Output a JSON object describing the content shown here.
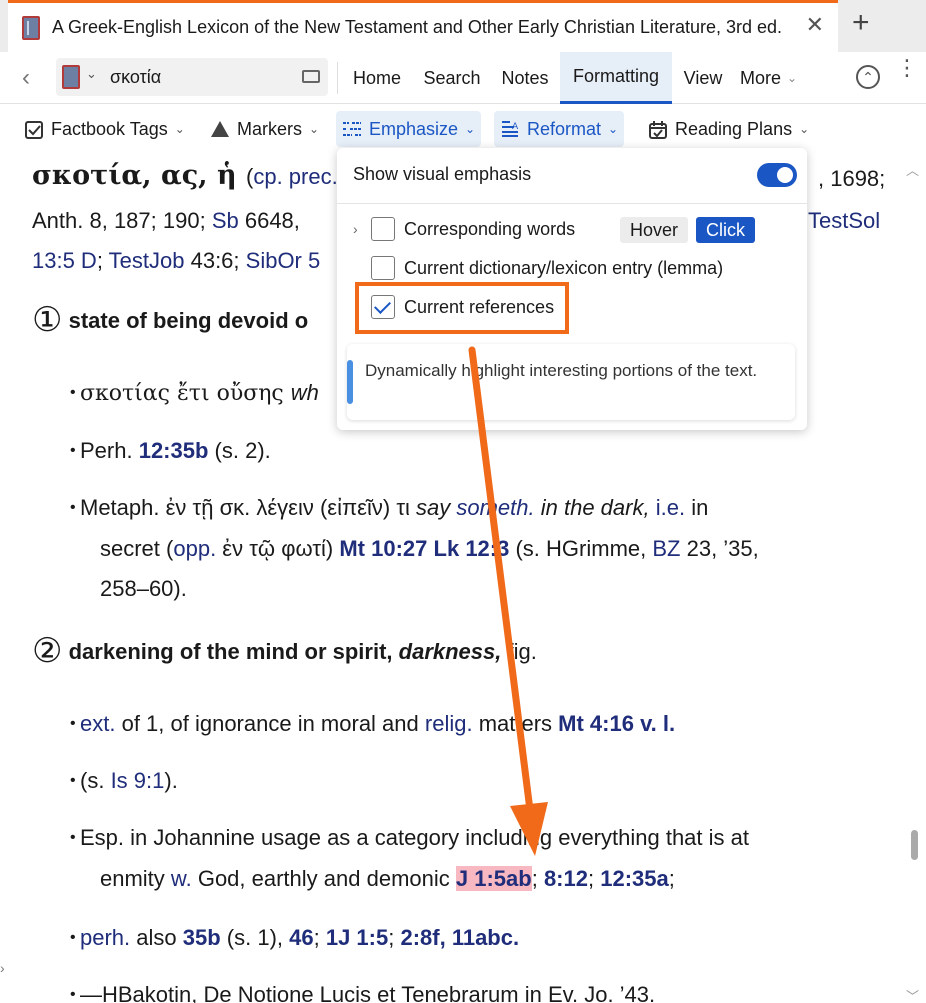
{
  "tab": {
    "title": "A Greek-English Lexicon of the New Testament and Other Early Christian Literature, 3rd ed.",
    "close": "✕",
    "add": "+"
  },
  "nav": {
    "reference": "σκοτία",
    "menus": [
      "Home",
      "Search",
      "Notes",
      "Formatting",
      "View",
      "More"
    ],
    "active_menu": "Formatting"
  },
  "toolbar": {
    "factbook": "Factbook Tags",
    "markers": "Markers",
    "emphasize": "Emphasize",
    "reformat": "Reformat",
    "reading_plans": "Reading Plans"
  },
  "panel": {
    "show_visual_emphasis": "Show visual emphasis",
    "corresponding_words": "Corresponding words",
    "hover": "Hover",
    "click": "Click",
    "current_lemma": "Current dictionary/lexicon entry (lemma)",
    "current_references": "Current references",
    "info": "Dynamically highlight interesting portions of the text.",
    "toggle_on": true
  },
  "entry": {
    "headword": "σκοτία, ας, ἡ",
    "l1_paren": "(",
    "l1_cp": "cp. prec.",
    "l1_end": ", 1698;",
    "l2a": "Anth. 8, 187; 190; ",
    "l2_sb": "Sb",
    "l2b": " 6648,",
    "l2_testsol": "TestSol",
    "l3_ref": "13:5 D",
    "l3_sep1": "; ",
    "l3_testjob": "TestJob",
    "l3_mid": " 43:6; ",
    "l3_sibor": "SibOr 5",
    "sense1_num": "①",
    "sense1": "state of being devoid o",
    "b1_greek": "σκοτίας ἔτι οὔσης ",
    "b1_wh": "wh",
    "b2_perh": "Perh. ",
    "b2_ref": "12:35b",
    "b2_end": " (s. 2).",
    "b3_a": "Metaph. ἐν τῇ σκ. λέγειν (εἰπεῖν) τι ",
    "b3_say": "say ",
    "b3_someth": "someth.",
    "b3_dark": " in the dark, ",
    "b3_ie": "i.e.",
    "b3_in": " in",
    "b3l2_a": "secret (",
    "b3l2_opp": "opp.",
    "b3l2_b": " ἐν τῷ φωτί) ",
    "b3l2_mt": "Mt 10:27",
    "b3l2_c": " ",
    "b3l2_lk": "Lk 12:3",
    "b3l2_d": " (s. HGrimme, ",
    "b3l2_bz": "BZ",
    "b3l2_e": " 23, ’35,",
    "b3l3": "258–60).",
    "sense2_num": "②",
    "sense2_a": "darkening of the mind or spirit, ",
    "sense2_b": "darkness,",
    "sense2_c": " fig.",
    "b4_ext": "ext.",
    "b4_a": " of 1, of ignorance in moral and ",
    "b4_relig": "relig.",
    "b4_b": " matters ",
    "b4_ref": "Mt 4:16 v. l.",
    "b5_a": "(s. ",
    "b5_is": "Is 9:1",
    "b5_b": ").",
    "b6_a": "Esp. in Johannine usage as a category including everything that is at",
    "b6l2_a": "enmity ",
    "b6l2_w": "w.",
    "b6l2_b": " God, earthly and demonic ",
    "b6l2_j": "J 1:5ab",
    "b6l2_c": "; ",
    "b6l2_r2": "8:12",
    "b6l2_d": "; ",
    "b6l2_r3": "12:35a",
    "b6l2_e": ";",
    "b7_perh": "perh.",
    "b7_a": " also ",
    "b7_35b": "35b",
    "b7_b": " (s. 1), ",
    "b7_46": "46",
    "b7_c": "; ",
    "b7_1j": "1J 1:5",
    "b7_d": "; ",
    "b7_28f": "2:8f, 11abc.",
    "b8": "—HBakotin, De Notione Lucis et Tenebrarum in Ev. Jo. ’43."
  },
  "colors": {
    "accent": "#1b57c4",
    "annotation": "#f06a1a",
    "highlight": "#f7b8c1",
    "link": "#1f2d7a"
  }
}
